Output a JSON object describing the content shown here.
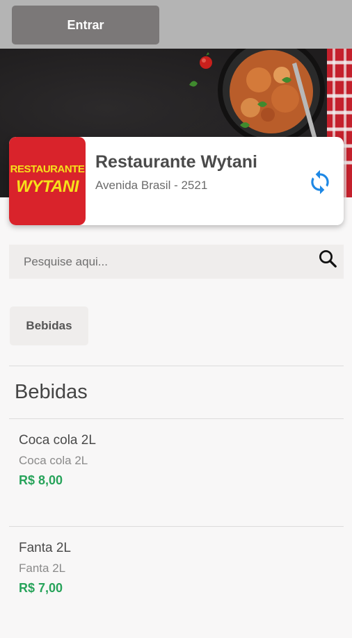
{
  "header": {
    "login_label": "Entrar"
  },
  "restaurant": {
    "logo_line1": "RESTAURANTE",
    "logo_line2": "WYTANI",
    "name": "Restaurante Wytani",
    "address": "Avenida Brasil - 2521"
  },
  "search": {
    "placeholder": "Pesquise aqui...",
    "value": ""
  },
  "categories": [
    {
      "label": "Bebidas"
    }
  ],
  "sections": [
    {
      "title": "Bebidas",
      "products": [
        {
          "name": "Coca cola 2L",
          "description": "Coca cola 2L",
          "price": "R$ 8,00"
        },
        {
          "name": "Fanta 2L",
          "description": "Fanta 2L",
          "price": "R$ 7,00"
        }
      ]
    }
  ],
  "colors": {
    "price": "#27a35a",
    "refresh_icon": "#1e88e5",
    "logo_bg": "#d9232b",
    "logo_text": "#f6e11b",
    "login_button": "#7b7878",
    "topbar": "#b4b4b4"
  },
  "icons": {
    "refresh": "refresh-icon",
    "search": "search-icon"
  }
}
